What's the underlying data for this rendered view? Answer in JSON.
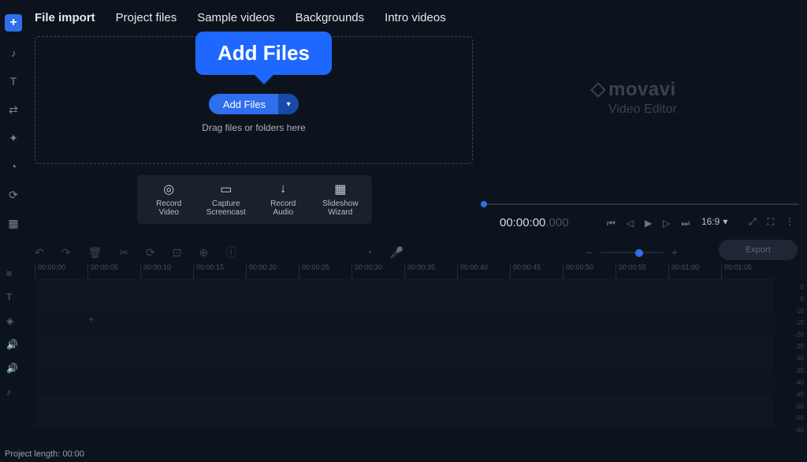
{
  "tabs": [
    "File import",
    "Project files",
    "Sample videos",
    "Backgrounds",
    "Intro videos"
  ],
  "tooltip_label": "Add Files",
  "addfiles_label": "Add Files",
  "drag_hint": "Drag files or folders here",
  "actions": [
    {
      "icon": "◎",
      "line1": "Record",
      "line2": "Video"
    },
    {
      "icon": "▭",
      "line1": "Capture",
      "line2": "Screencast"
    },
    {
      "icon": "↓",
      "line1": "Record",
      "line2": "Audio"
    },
    {
      "icon": "▦",
      "line1": "Slideshow",
      "line2": "Wizard"
    }
  ],
  "watermark": {
    "brand": "movavi",
    "sub": "Video Editor"
  },
  "timecode": {
    "main": "00:00:00",
    "frac": ".000"
  },
  "aspect_ratio": "16:9",
  "export_label": "Export",
  "ruler": [
    "00:00:00",
    "00:00:05",
    "00:00:10",
    "00:00:15",
    "00:00:20",
    "00:00:25",
    "00:00:30",
    "00:00:35",
    "00:00:40",
    "00:00:45",
    "00:00:50",
    "00:00:55",
    "00:01:00",
    "00:01:05"
  ],
  "db_marks": [
    "0",
    "-5",
    "-10",
    "-15",
    "-20",
    "-25",
    "-30",
    "-35",
    "-40",
    "-45",
    "-50",
    "-55",
    "-60"
  ],
  "status": "Project length: 00:00",
  "vtools": [
    "♪",
    "T",
    "⇄",
    "✦",
    "◔",
    "⟳",
    "▦"
  ],
  "timeline_tools": [
    "↶",
    "↷",
    "🗑",
    "✂",
    "⟳",
    "⊡",
    "⊕",
    "ⓘ",
    "◔",
    "🎤"
  ],
  "playback": [
    "⏮",
    "◁",
    "▶",
    "▷",
    "⏭"
  ],
  "rightmini": [
    "⤢",
    "⛶",
    "⋮"
  ],
  "track_icons": [
    "≡",
    "T",
    "◈",
    "🔊",
    "🔊",
    "♪"
  ]
}
